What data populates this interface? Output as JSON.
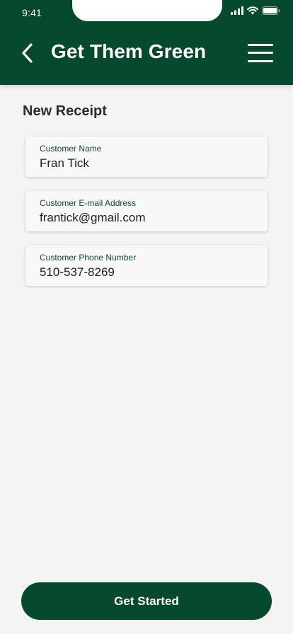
{
  "status_bar": {
    "time": "9:41"
  },
  "header": {
    "title": "Get Them Green",
    "back_icon": "chevron-left-icon",
    "menu_icon": "hamburger-menu-icon"
  },
  "page": {
    "title": "New Receipt"
  },
  "fields": [
    {
      "label": "Customer Name",
      "value": "Fran Tick"
    },
    {
      "label": "Customer E-mail Address",
      "value": "frantick@gmail.com"
    },
    {
      "label": "Customer Phone Number",
      "value": "510-537-8269"
    }
  ],
  "cta": {
    "label": "Get Started"
  },
  "colors": {
    "brand_green": "#064a2d",
    "background": "#f4f4f4",
    "field_label": "#0a4a2e"
  }
}
